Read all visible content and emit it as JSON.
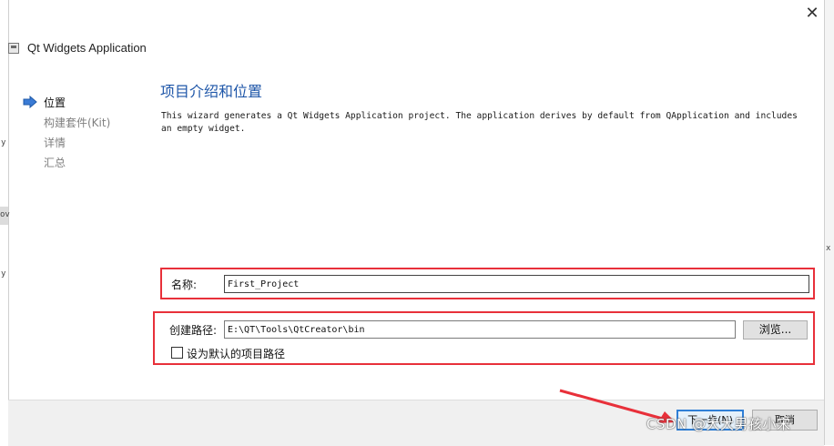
{
  "window": {
    "title": "Qt Widgets Application",
    "close_symbol": "✕"
  },
  "steps": [
    {
      "label": "位置",
      "active": true
    },
    {
      "label": "构建套件(Kit)",
      "active": false
    },
    {
      "label": "详情",
      "active": false
    },
    {
      "label": "汇总",
      "active": false
    }
  ],
  "page": {
    "title": "项目介绍和位置",
    "description": "This wizard generates a Qt Widgets Application project. The application derives by default from QApplication and includes an empty widget."
  },
  "form": {
    "name_label": "名称:",
    "name_value": "First_Project",
    "path_label": "创建路径:",
    "path_value": "E:\\QT\\Tools\\QtCreator\\bin",
    "browse_label": "浏览...",
    "default_path_label": "设为默认的项目路径",
    "default_path_checked": false
  },
  "buttons": {
    "next_label": "下一步(N)",
    "cancel_label": "取消"
  },
  "background": {
    "left_fragments": [
      "y",
      "ov",
      "y"
    ],
    "right_fragments": [
      "x"
    ]
  },
  "watermark": "CSDN @大大男孩小宋",
  "colors": {
    "accent": "#1e56a8",
    "annotation_red": "#e8303a",
    "focus_blue": "#2f7fd6",
    "step_arrow": "#3a7bd5"
  }
}
